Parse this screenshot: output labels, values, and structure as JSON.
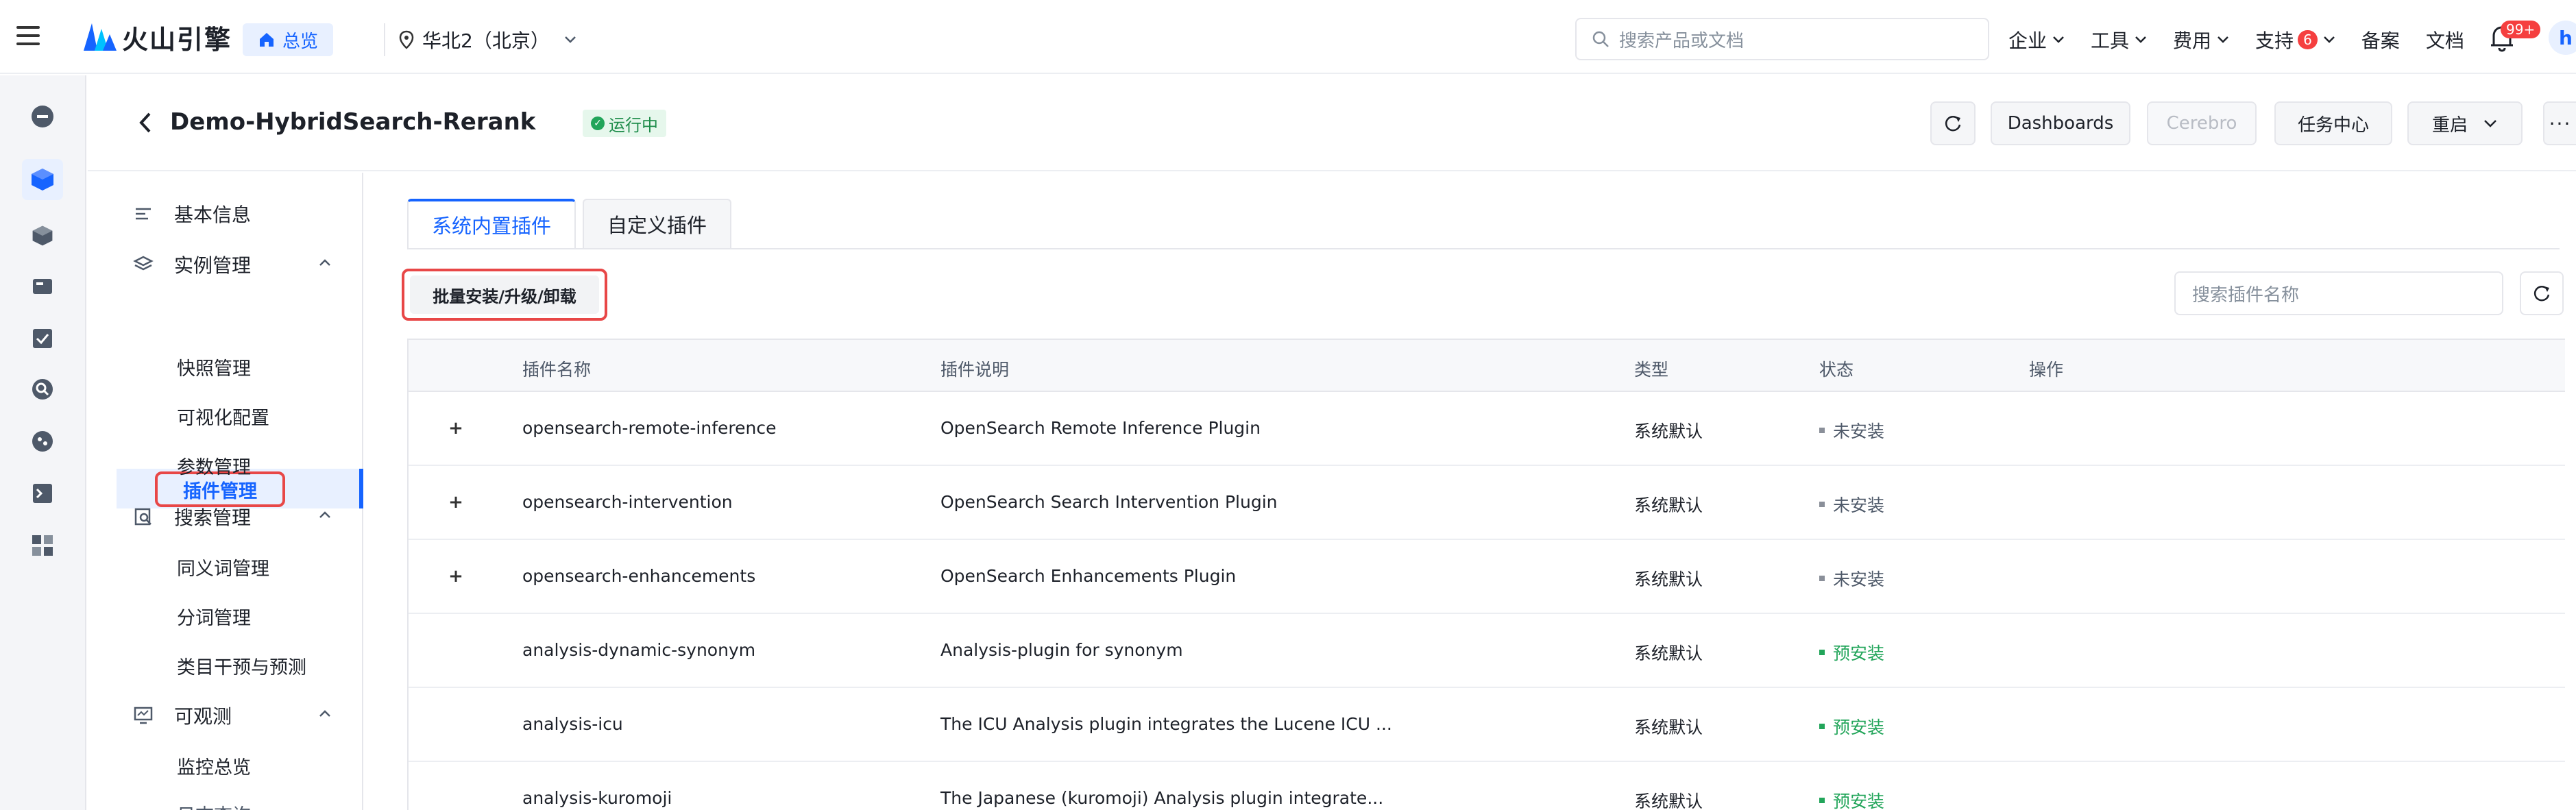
{
  "topbar": {
    "logo_text": "火山引擎",
    "home_label": "总览",
    "region": "华北2（北京）",
    "search_placeholder": "搜索产品或文档",
    "nav": [
      {
        "label": "企业",
        "dropdown": true
      },
      {
        "label": "工具",
        "dropdown": true
      },
      {
        "label": "费用",
        "dropdown": true
      },
      {
        "label": "支持",
        "badge": "6",
        "dropdown": true
      },
      {
        "label": "备案",
        "dropdown": false
      },
      {
        "label": "文档",
        "dropdown": false
      }
    ],
    "notification_badge": "99+",
    "avatar_initial": "h"
  },
  "header": {
    "title": "Demo-HybridSearch-Rerank",
    "status": "运行中",
    "buttons": {
      "dashboards": "Dashboards",
      "cerebro": "Cerebro",
      "task_center": "任务中心",
      "restart": "重启"
    }
  },
  "sidebar": {
    "basic_info": "基本信息",
    "instance_mgmt": "实例管理",
    "plugin_mgmt": "插件管理",
    "snapshot_mgmt": "快照管理",
    "visual_config": "可视化配置",
    "param_mgmt": "参数管理",
    "search_mgmt": "搜索管理",
    "synonym_mgmt": "同义词管理",
    "tokenizer_mgmt": "分词管理",
    "category_intervention": "类目干预与预测",
    "observability": "可观测",
    "monitor_overview": "监控总览",
    "partial_item": "日志查询"
  },
  "tabs": {
    "builtin": "系统内置插件",
    "custom": "自定义插件"
  },
  "toolbar": {
    "batch_label": "批量安装/升级/卸载",
    "search_placeholder": "搜索插件名称"
  },
  "table": {
    "columns": {
      "name": "插件名称",
      "desc": "插件说明",
      "type": "类型",
      "status": "状态",
      "action": "操作"
    },
    "rows": [
      {
        "name": "opensearch-remote-inference",
        "desc": "OpenSearch Remote Inference Plugin",
        "type": "系统默认",
        "status": "未安装",
        "expandable": true
      },
      {
        "name": "opensearch-intervention",
        "desc": "OpenSearch Search Intervention Plugin",
        "type": "系统默认",
        "status": "未安装",
        "expandable": true
      },
      {
        "name": "opensearch-enhancements",
        "desc": "OpenSearch Enhancements Plugin",
        "type": "系统默认",
        "status": "未安装",
        "expandable": true
      },
      {
        "name": "analysis-dynamic-synonym",
        "desc": "Analysis-plugin for synonym",
        "type": "系统默认",
        "status": "预安装",
        "expandable": false
      },
      {
        "name": "analysis-icu",
        "desc": "The ICU Analysis plugin integrates the Lucene ICU ...",
        "type": "系统默认",
        "status": "预安装",
        "expandable": false
      },
      {
        "name": "analysis-kuromoji",
        "desc": "The Japanese (kuromoji) Analysis plugin integrate...",
        "type": "系统默认",
        "status": "预安装",
        "expandable": false
      }
    ]
  },
  "colors": {
    "accent": "#1664ff",
    "status_not_installed": "#8a8f99",
    "status_preinstalled": "#22a55a",
    "highlight_outline": "#e84747"
  }
}
